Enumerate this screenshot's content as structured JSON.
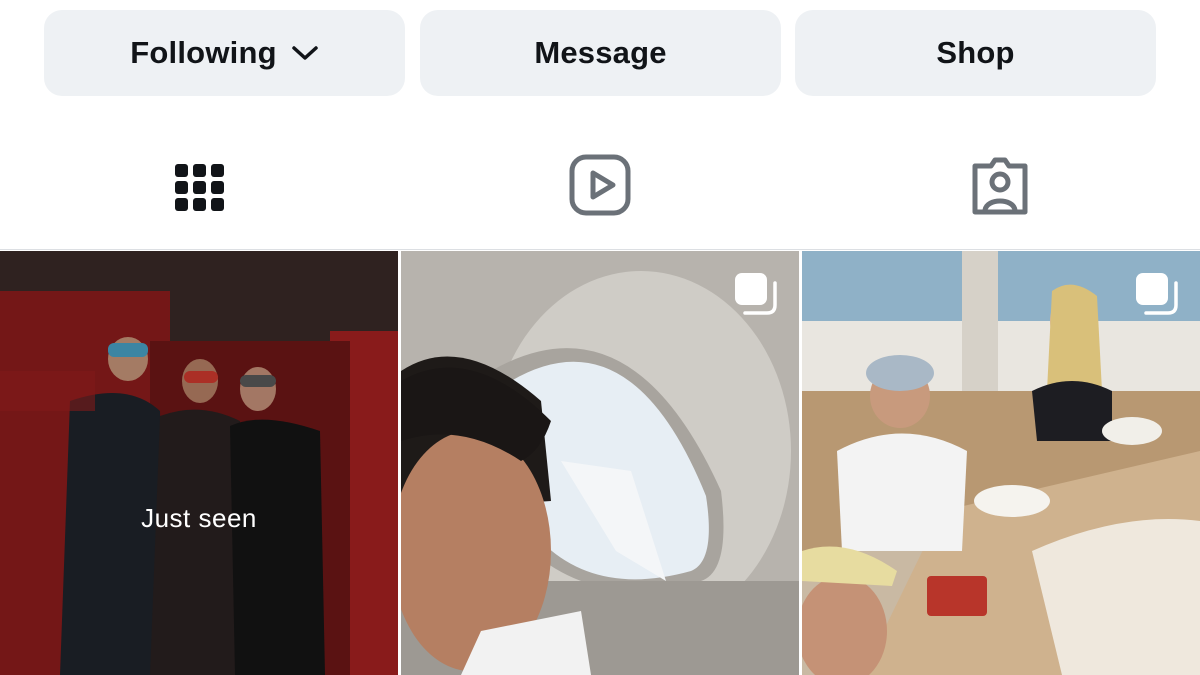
{
  "actions": {
    "following_label": "Following",
    "message_label": "Message",
    "shop_label": "Shop"
  },
  "tabs": [
    {
      "name": "grid",
      "icon": "grid-icon",
      "active": true
    },
    {
      "name": "reels",
      "icon": "reels-icon",
      "active": false
    },
    {
      "name": "tagged",
      "icon": "tagged-icon",
      "active": false
    }
  ],
  "posts": [
    {
      "overlay_text": "Just seen",
      "multi": false
    },
    {
      "multi": true
    },
    {
      "multi": true
    }
  ],
  "colors": {
    "button_bg": "#eef1f4",
    "text": "#111418",
    "icon_inactive": "#6b7178"
  }
}
